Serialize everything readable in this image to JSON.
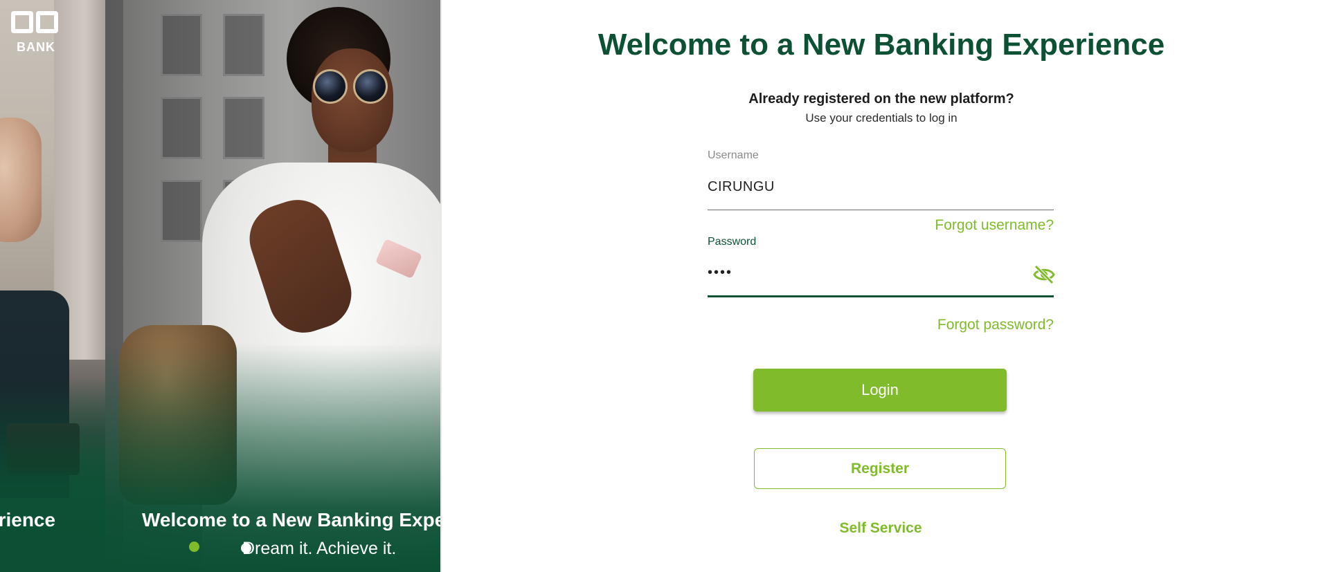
{
  "brand": {
    "logo_text": "BANK"
  },
  "hero": {
    "previous_caption": "erience",
    "caption": "Welcome to a New Banking Expe",
    "subcaption": "Dream it. Achieve it.",
    "slide_count": 2,
    "active_slide": 1
  },
  "login": {
    "title": "Welcome to a New Banking Experience",
    "question": "Already registered on the new platform?",
    "hint": "Use your credentials to log in",
    "username_label": "Username",
    "username_value": "CIRUNGU",
    "forgot_username": "Forgot username?",
    "password_label": "Password",
    "password_value": "••••",
    "forgot_password": "Forgot password?",
    "login_button": "Login",
    "register_button": "Register",
    "self_service": "Self Service",
    "password_visibility_icon": "eye-slash-icon"
  },
  "colors": {
    "brand_dark_green": "#0c5134",
    "accent_green": "#7fbb2b",
    "white": "#ffffff"
  }
}
